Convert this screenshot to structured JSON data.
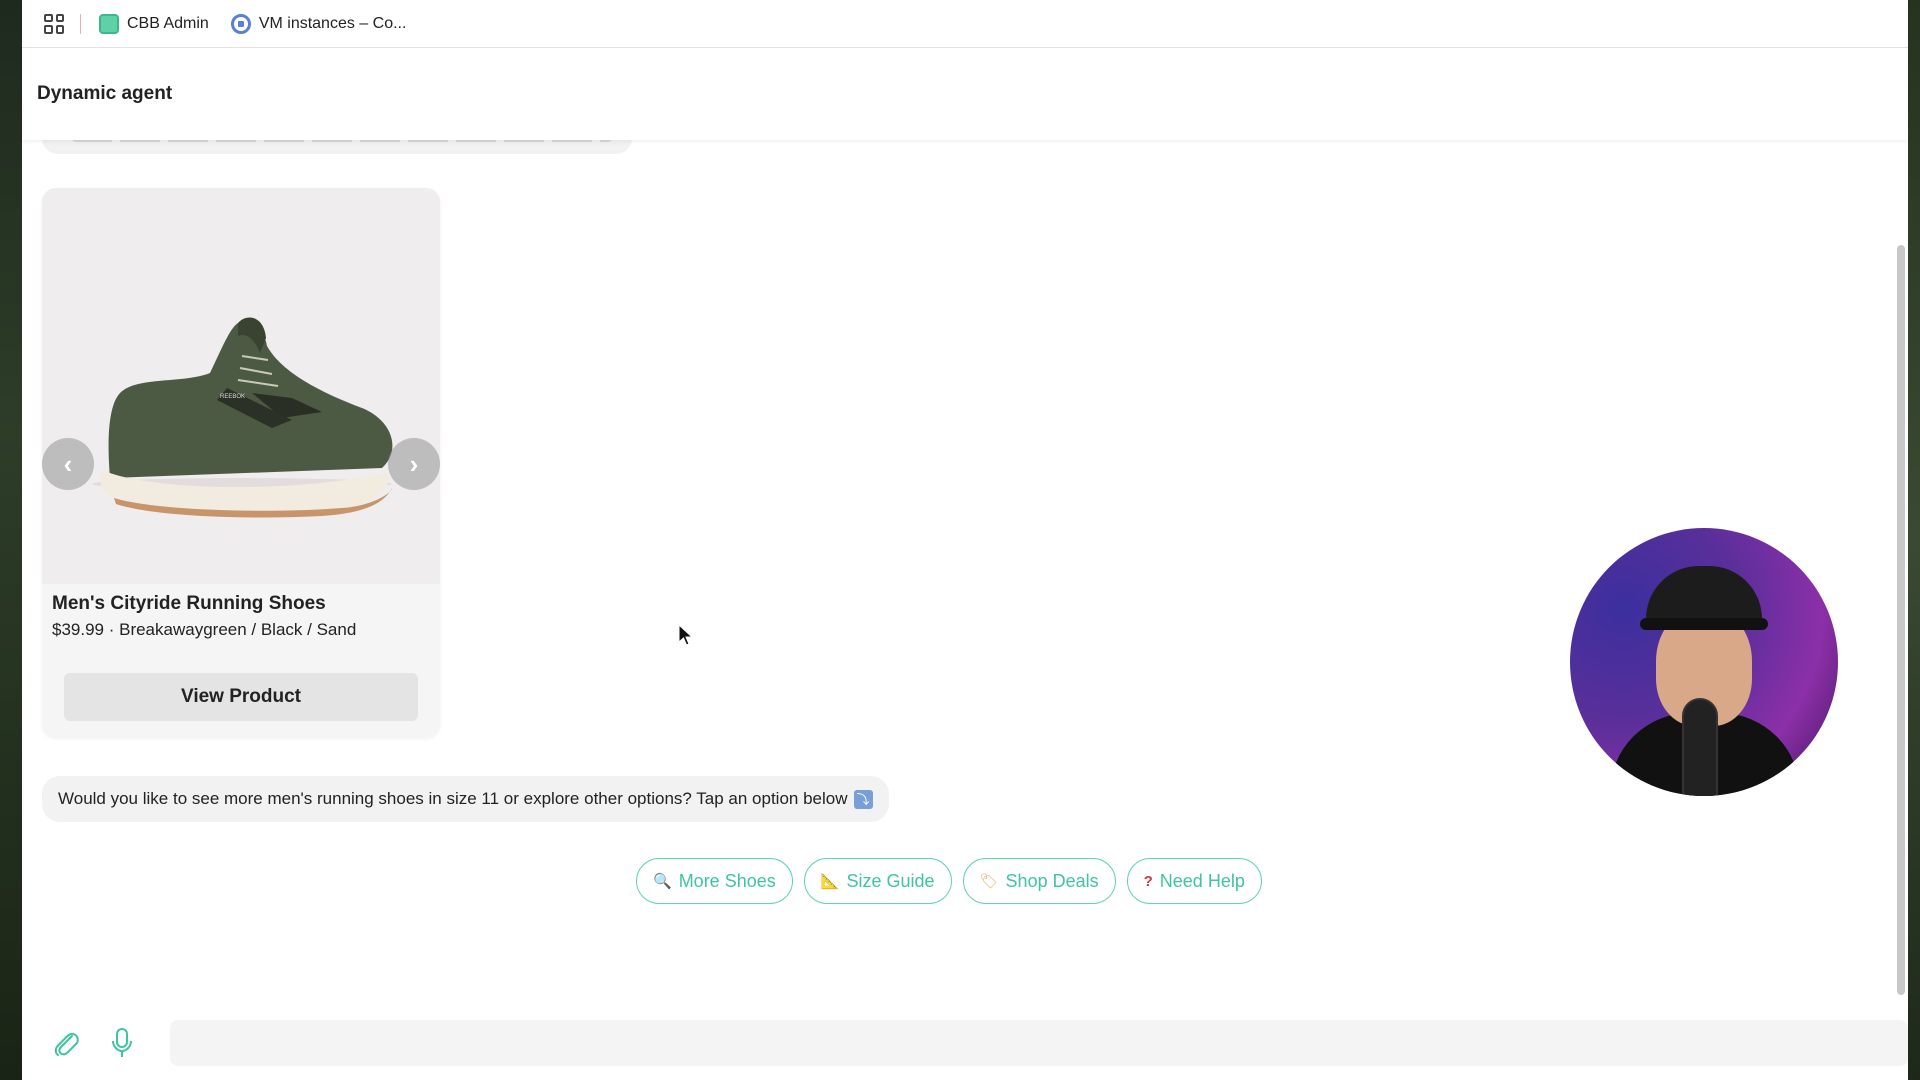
{
  "bookmarks_bar": {
    "items": [
      {
        "label": "CBB Admin",
        "icon": "cbb-logo-icon"
      },
      {
        "label": "VM instances – Co...",
        "icon": "gcp-compute-icon"
      }
    ]
  },
  "header": {
    "title": "Dynamic agent"
  },
  "product_card": {
    "title": "Men's Cityride Running Shoes",
    "subtitle": "$39.99 · Breakawaygreen / Black / Sand",
    "cta_label": "View Product",
    "prev_glyph": "‹",
    "next_glyph": "›"
  },
  "bot_message": {
    "text": "Would you like to see more men's running shoes in size 11 or explore other options? Tap an option below",
    "emoji": "⤵"
  },
  "quick_replies": [
    {
      "icon": "🔍",
      "label": "More Shoes"
    },
    {
      "icon": "📐",
      "label": "Size Guide"
    },
    {
      "icon": "🏷",
      "label": "Shop Deals"
    },
    {
      "icon": "?",
      "label": "Need Help"
    }
  ],
  "composer": {
    "placeholder": ""
  },
  "colors": {
    "accent": "#3fc4a2",
    "accent_border": "#5ed3b6",
    "bubble_bg": "#f2f2f2"
  }
}
